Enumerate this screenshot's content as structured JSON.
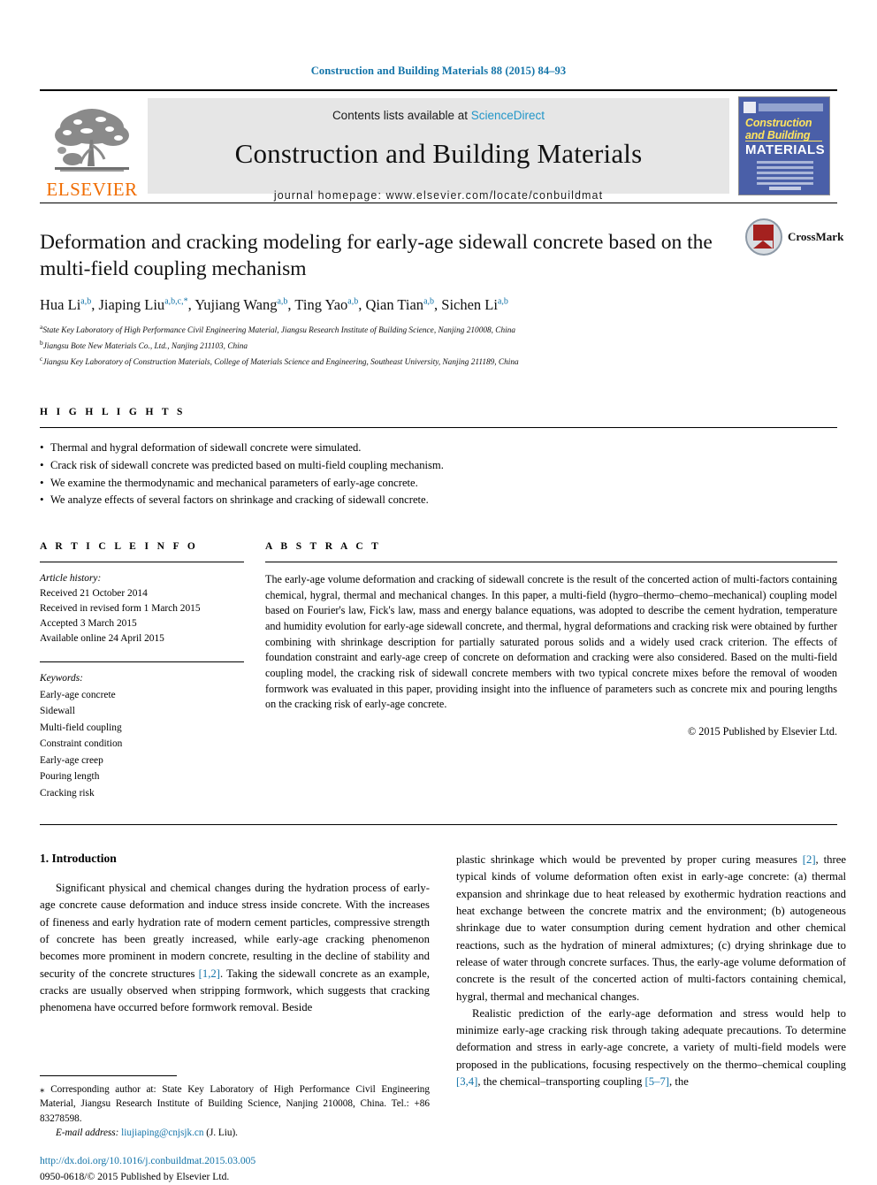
{
  "running_head": "Construction and Building Materials 88 (2015) 84–93",
  "masthead": {
    "publisher_name": "ELSEVIER",
    "contents_prefix": "Contents lists available at ",
    "sciencedirect": "ScienceDirect",
    "journal_title": "Construction and Building Materials",
    "homepage": "journal homepage: www.elsevier.com/locate/conbuildmat",
    "cover": {
      "line1": "Construction",
      "line2": "and Building",
      "line3": "MATERIALS"
    }
  },
  "title": "Deformation and cracking modeling for early-age sidewall concrete based on the multi-field coupling mechanism",
  "crossmark_label": "CrossMark",
  "authors": [
    {
      "name": "Hua Li",
      "sup": "a,b"
    },
    {
      "name": "Jiaping Liu",
      "sup": "a,b,c,*"
    },
    {
      "name": "Yujiang Wang",
      "sup": "a,b"
    },
    {
      "name": "Ting Yao",
      "sup": "a,b"
    },
    {
      "name": "Qian Tian",
      "sup": "a,b"
    },
    {
      "name": "Sichen Li",
      "sup": "a,b"
    }
  ],
  "affiliations": [
    {
      "marker": "a",
      "text": "State Key Laboratory of High Performance Civil Engineering Material, Jiangsu Research Institute of Building Science, Nanjing 210008, China"
    },
    {
      "marker": "b",
      "text": "Jiangsu Bote New Materials Co., Ltd., Nanjing 211103, China"
    },
    {
      "marker": "c",
      "text": "Jiangsu Key Laboratory of Construction Materials, College of Materials Science and Engineering, Southeast University, Nanjing 211189, China"
    }
  ],
  "highlights": {
    "heading": "H I G H L I G H T S",
    "items": [
      "Thermal and hygral deformation of sidewall concrete were simulated.",
      "Crack risk of sidewall concrete was predicted based on multi-field coupling mechanism.",
      "We examine the thermodynamic and mechanical parameters of early-age concrete.",
      "We analyze effects of several factors on shrinkage and cracking of sidewall concrete."
    ]
  },
  "article_info": {
    "heading": "A R T I C L E  I N F O",
    "history_title": "Article history:",
    "history": [
      "Received 21 October 2014",
      "Received in revised form 1 March 2015",
      "Accepted 3 March 2015",
      "Available online 24 April 2015"
    ],
    "keywords_title": "Keywords:",
    "keywords": [
      "Early-age concrete",
      "Sidewall",
      "Multi-field coupling",
      "Constraint condition",
      "Early-age creep",
      "Pouring length",
      "Cracking risk"
    ]
  },
  "abstract": {
    "heading": "A B S T R A C T",
    "text": "The early-age volume deformation and cracking of sidewall concrete is the result of the concerted action of multi-factors containing chemical, hygral, thermal and mechanical changes. In this paper, a multi-field (hygro–thermo–chemo–mechanical) coupling model based on Fourier's law, Fick's law, mass and energy balance equations, was adopted to describe the cement hydration, temperature and humidity evolution for early-age sidewall concrete, and thermal, hygral deformations and cracking risk were obtained by further combining with shrinkage description for partially saturated porous solids and a widely used crack criterion. The effects of foundation constraint and early-age creep of concrete on deformation and cracking were also considered. Based on the multi-field coupling model, the cracking risk of sidewall concrete members with two typical concrete mixes before the removal of wooden formwork was evaluated in this paper, providing insight into the influence of parameters such as concrete mix and pouring lengths on the cracking risk of early-age concrete.",
    "copyright": "© 2015 Published by Elsevier Ltd."
  },
  "introduction": {
    "heading": "1. Introduction",
    "left_paragraph": "Significant physical and chemical changes during the hydration process of early-age concrete cause deformation and induce stress inside concrete. With the increases of fineness and early hydration rate of modern cement particles, compressive strength of concrete has been greatly increased, while early-age cracking phenomenon becomes more prominent in modern concrete, resulting in the decline of stability and security of the concrete structures ",
    "left_ref": "[1,2]",
    "left_paragraph_2": ". Taking the sidewall concrete as an example, cracks are usually observed when stripping formwork, which suggests that cracking phenomena have occurred before formwork removal. Beside",
    "right_p1_a": "plastic shrinkage which would be prevented by proper curing measures ",
    "right_p1_ref": "[2]",
    "right_p1_b": ", three typical kinds of volume deformation often exist in early-age concrete: (a) thermal expansion and shrinkage due to heat released by exothermic hydration reactions and heat exchange between the concrete matrix and the environment; (b) autogeneous shrinkage due to water consumption during cement hydration and other chemical reactions, such as the hydration of mineral admixtures; (c) drying shrinkage due to release of water through concrete surfaces. Thus, the early-age volume deformation of concrete is the result of the concerted action of multi-factors containing chemical, hygral, thermal and mechanical changes.",
    "right_p2_a": "Realistic prediction of the early-age deformation and stress would help to minimize early-age cracking risk through taking adequate precautions. To determine deformation and stress in early-age concrete, a variety of multi-field models were proposed in the publications, focusing respectively on the thermo–chemical coupling ",
    "right_p2_ref1": "[3,4]",
    "right_p2_b": ", the chemical–transporting coupling ",
    "right_p2_ref2": "[5–7]",
    "right_p2_c": ", the"
  },
  "footnote": {
    "corresponding": "⁎ Corresponding author at: State Key Laboratory of High Performance Civil Engineering Material, Jiangsu Research Institute of Building Science, Nanjing 210008, China. Tel.: +86 83278598.",
    "email_label": "E-mail address:",
    "email": "liujiaping@cnjsjk.cn",
    "email_suffix": "(J. Liu)."
  },
  "doi": "http://dx.doi.org/10.1016/j.conbuildmat.2015.03.005",
  "issn_line": "0950-0618/© 2015 Published by Elsevier Ltd.",
  "colors": {
    "link": "#1273a8",
    "elsevier_orange": "#f06c00",
    "sciencedirect": "#2196c8",
    "band_gray": "#e6e6e6"
  }
}
